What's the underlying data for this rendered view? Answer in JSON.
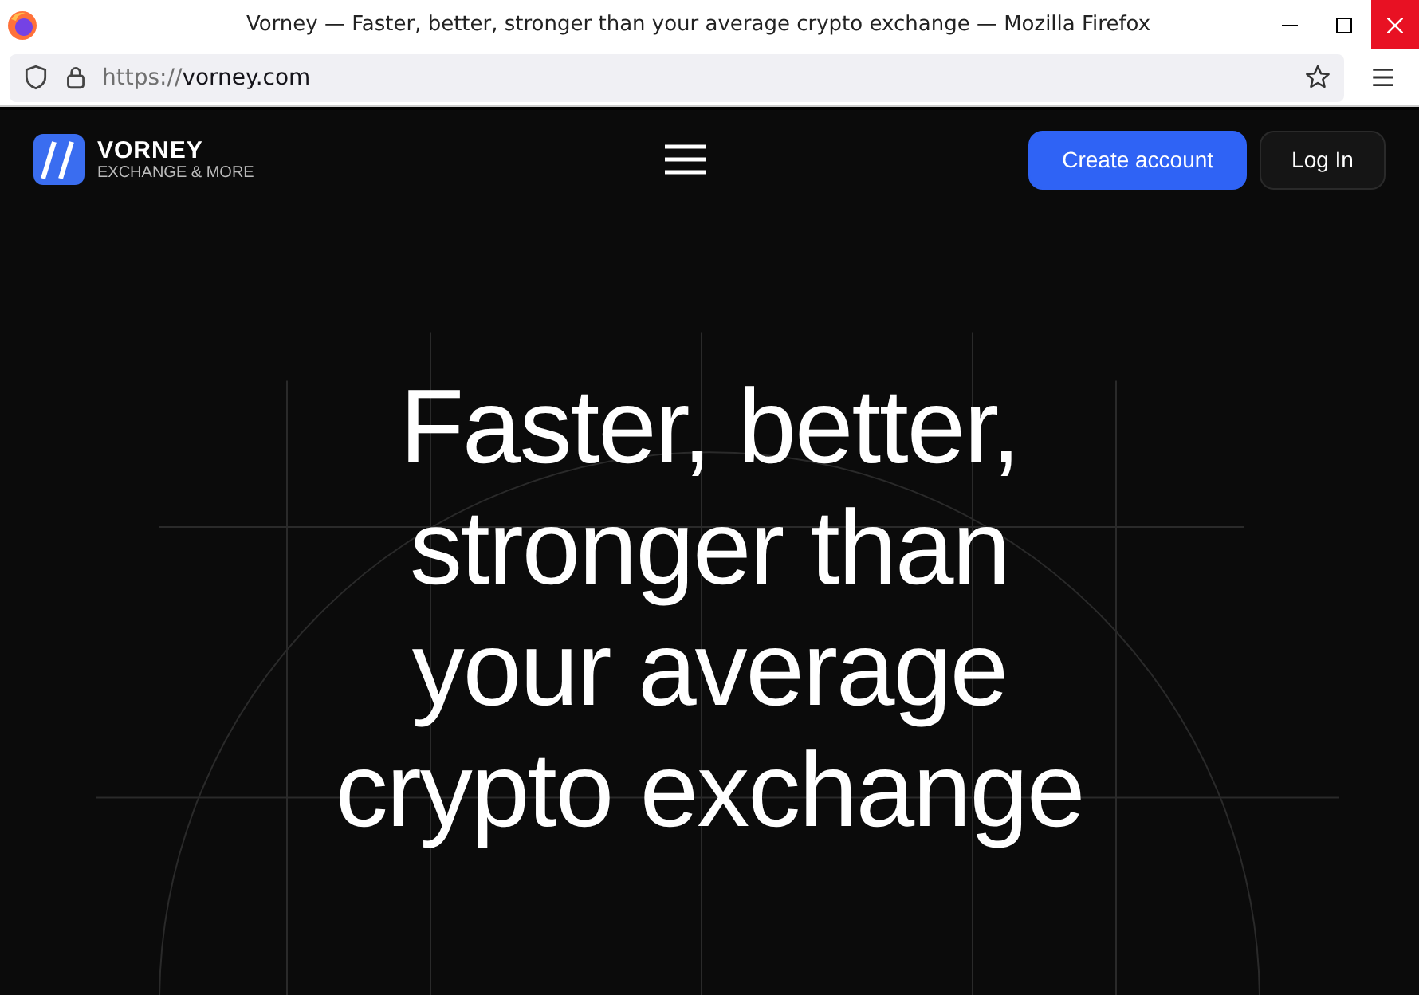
{
  "window": {
    "title": "Vorney — Faster, better, stronger than your average crypto exchange — Mozilla Firefox"
  },
  "address_bar": {
    "scheme": "https://",
    "host": "vorney.com"
  },
  "site_header": {
    "logo_name": "VORNEY",
    "logo_tagline": "EXCHANGE & MORE",
    "buttons": [
      {
        "label": "Create account",
        "kind": "primary"
      },
      {
        "label": "Log In",
        "kind": "secondary"
      }
    ]
  },
  "hero": {
    "headline": "Faster, better, stronger than your average crypto exchange"
  }
}
